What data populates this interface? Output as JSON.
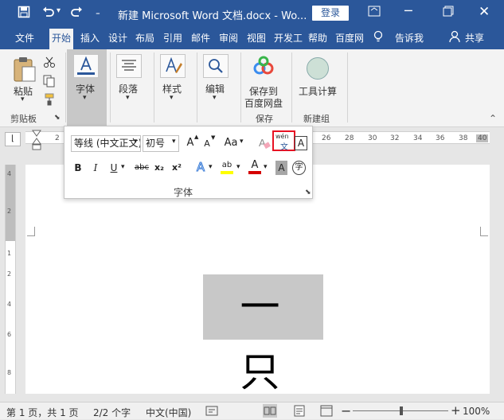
{
  "window": {
    "title": "新建 Microsoft Word 文档.docx  -  Wo...",
    "login_label": "登录",
    "quick_access": [
      "save-icon",
      "undo-icon",
      "redo-icon",
      "customize-icon"
    ],
    "controls": [
      "ribbon-display-icon",
      "minimize-icon",
      "restore-icon",
      "close-icon"
    ]
  },
  "tabs": [
    {
      "label": "文件"
    },
    {
      "label": "开始"
    },
    {
      "label": "插入"
    },
    {
      "label": "设计"
    },
    {
      "label": "布局"
    },
    {
      "label": "引用"
    },
    {
      "label": "邮件"
    },
    {
      "label": "审阅"
    },
    {
      "label": "视图"
    },
    {
      "label": "开发工"
    },
    {
      "label": "帮助"
    },
    {
      "label": "百度网"
    }
  ],
  "tell_me": "告诉我",
  "share": "共享",
  "ribbon": {
    "paste_label": "粘贴",
    "clipboard_group": "剪贴板",
    "font_label": "字体",
    "paragraph_label": "段落",
    "styles_label": "样式",
    "editing_label": "编辑",
    "save_baidu_line1": "保存到",
    "save_baidu_line2": "百度网盘",
    "save_group": "保存",
    "tool_calc_label": "工具计算",
    "new_group": "新建组"
  },
  "font_popup": {
    "font_name": "等线 (中文正文)",
    "font_size": "初号",
    "grow_font": "A",
    "shrink_font": "A",
    "change_case": "Aa",
    "phonetic_top": "wén",
    "phonetic_bottom": "文",
    "char_border": "A",
    "bold": "B",
    "italic": "I",
    "underline": "U",
    "strike": "abc",
    "subscript": "x₂",
    "superscript": "x²",
    "text_effects": "A",
    "highlight": "ab",
    "font_color": "A",
    "char_shade": "A",
    "enclose_char": "字",
    "group_label": "字体"
  },
  "document": {
    "text": "一只"
  },
  "ruler": {
    "h_ticks": [
      "2",
      "26",
      "28",
      "30",
      "32",
      "34",
      "36",
      "38",
      "40"
    ],
    "v_ticks": [
      "4",
      "2",
      "1",
      "2",
      "4",
      "6",
      "8"
    ]
  },
  "status": {
    "page": "第 1 页，共 1 页",
    "words": "2/2 个字",
    "language": "中文(中国)",
    "zoom": "100%"
  },
  "colors": {
    "title_blue": "#2b579a",
    "highlight_red": "#e81123",
    "text_highlight_yellow": "#ffff00",
    "font_color_red": "#d50000"
  }
}
